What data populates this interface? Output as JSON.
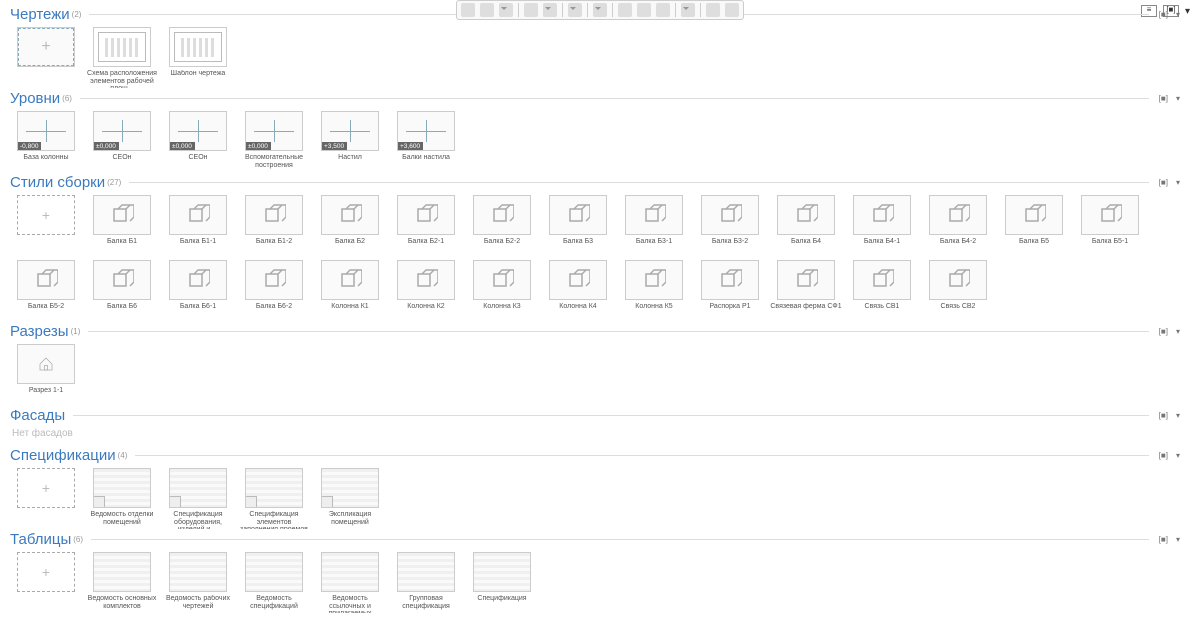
{
  "toolbar": {
    "groups": 6
  },
  "sections": {
    "drawings": {
      "title": "Чертежи",
      "count": "(2)"
    },
    "levels": {
      "title": "Уровни",
      "count": "(6)"
    },
    "assembly": {
      "title": "Стили сборки",
      "count": "(27)"
    },
    "razrezy": {
      "title": "Разрезы",
      "count": "(1)"
    },
    "fasady": {
      "title": "Фасады",
      "empty": "Нет фасадов"
    },
    "specs": {
      "title": "Спецификации",
      "count": "(4)"
    },
    "tables": {
      "title": "Таблицы",
      "count": "(6)"
    }
  },
  "drawings": [
    {
      "label": "Схема расположения элементов рабочей площ..."
    },
    {
      "label": "Шаблон чертежа"
    }
  ],
  "levels": [
    {
      "tag": "-0,800",
      "label": "База колонны"
    },
    {
      "tag": "±0,000",
      "label": "СЕОн"
    },
    {
      "tag": "±0,000",
      "label": "СЕОн"
    },
    {
      "tag": "±0,000",
      "label": "Вспомогательные построения"
    },
    {
      "tag": "+3,500",
      "label": "Настил"
    },
    {
      "tag": "+3,600",
      "label": "Балки настила"
    }
  ],
  "assembly": [
    {
      "label": "Балка Б1"
    },
    {
      "label": "Балка Б1-1"
    },
    {
      "label": "Балка Б1-2"
    },
    {
      "label": "Балка Б2"
    },
    {
      "label": "Балка Б2-1"
    },
    {
      "label": "Балка Б2-2"
    },
    {
      "label": "Балка Б3"
    },
    {
      "label": "Балка Б3-1"
    },
    {
      "label": "Балка Б3-2"
    },
    {
      "label": "Балка Б4"
    },
    {
      "label": "Балка Б4-1"
    },
    {
      "label": "Балка Б4-2"
    },
    {
      "label": "Балка Б5"
    },
    {
      "label": "Балка Б5-1"
    },
    {
      "label": "Балка Б5-2"
    },
    {
      "label": "Балка Б6"
    },
    {
      "label": "Балка Б6-1"
    },
    {
      "label": "Балка Б6-2"
    },
    {
      "label": "Колонна К1"
    },
    {
      "label": "Колонна К2"
    },
    {
      "label": "Колонна К3"
    },
    {
      "label": "Колонна К4"
    },
    {
      "label": "Колонна К5"
    },
    {
      "label": "Распорка Р1"
    },
    {
      "label": "Связевая ферма СФ1"
    },
    {
      "label": "Связь СВ1"
    },
    {
      "label": "Связь СВ2"
    }
  ],
  "razrezy": [
    {
      "label": "Разрез 1-1"
    }
  ],
  "specs": [
    {
      "label": "Ведомость отделки помещений"
    },
    {
      "label": "Спецификация оборудования, изделий и ..."
    },
    {
      "label": "Спецификация элементов заполнения проемов"
    },
    {
      "label": "Экспликация помещений"
    }
  ],
  "tables": [
    {
      "label": "Ведомость основных комплектов"
    },
    {
      "label": "Ведомость рабочих чертежей"
    },
    {
      "label": "Ведомость спецификаций"
    },
    {
      "label": "Ведомость ссылочных и прилагаемых документов"
    },
    {
      "label": "Групповая спецификация"
    },
    {
      "label": "Спецификация"
    }
  ],
  "add": "+"
}
